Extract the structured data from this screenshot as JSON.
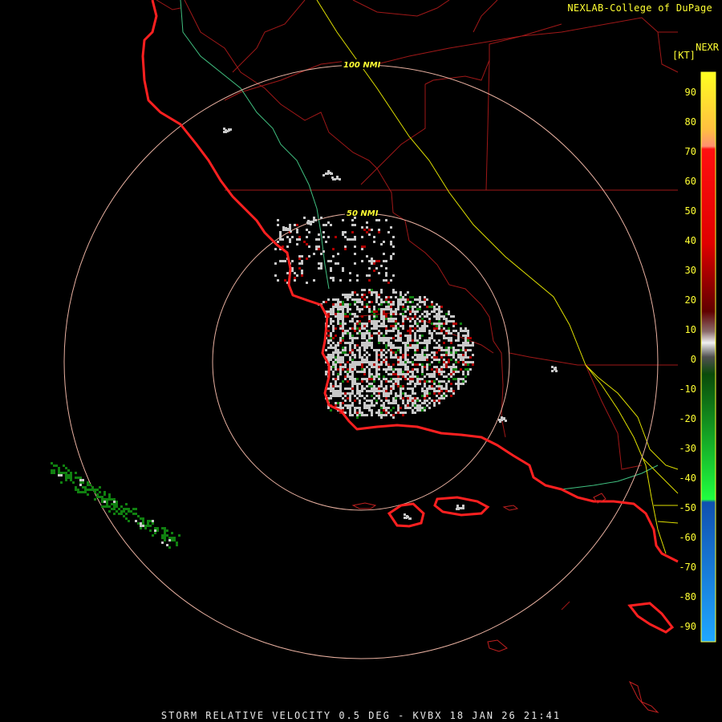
{
  "credit": "NEXLAB-College of DuPage",
  "legend": {
    "product": "NEXR",
    "unit": "[KT]",
    "ticks": [
      90,
      80,
      70,
      60,
      50,
      40,
      30,
      20,
      10,
      0,
      -10,
      -20,
      -30,
      -40,
      -50,
      -60,
      -70,
      -80,
      -90
    ]
  },
  "range_rings": [
    {
      "label": "100 NMI"
    },
    {
      "label": "50 NMI"
    }
  ],
  "footer": "STORM RELATIVE VELOCITY 0.5 DEG - KVBX 18 JAN 26 21:41",
  "colors": {
    "coast": "#ff2020",
    "county": "#b01818",
    "highway_yellow": "#e6e600",
    "river_green": "#40c080",
    "ring": "#e8b0a0",
    "echo_gray": "#c8c8c8",
    "echo_green": "#108010",
    "echo_red": "#b00000"
  }
}
